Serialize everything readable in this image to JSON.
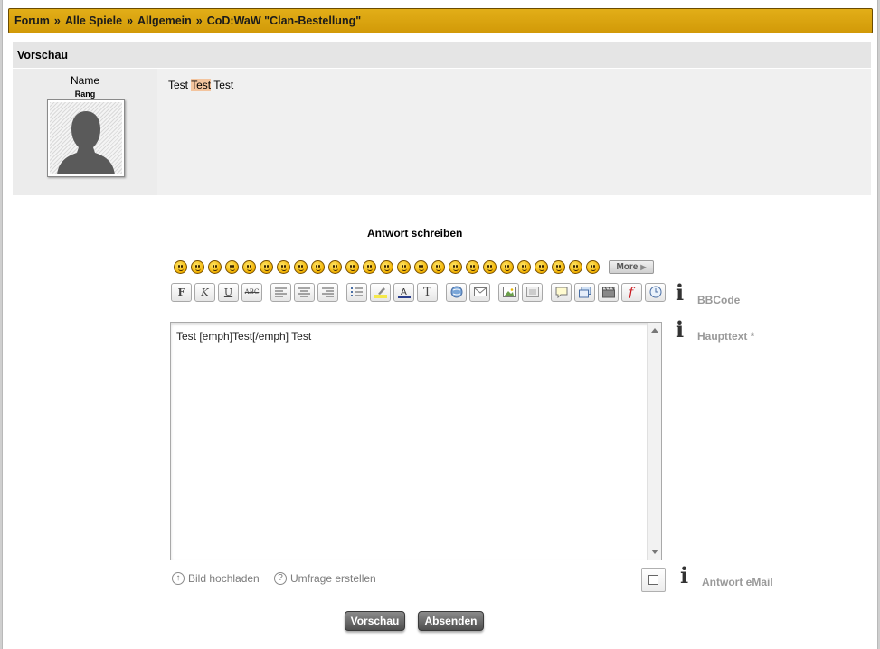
{
  "breadcrumb": {
    "items": [
      "Forum",
      "Alle Spiele",
      "Allgemein",
      "CoD:WaW \"Clan-Bestellung\""
    ],
    "separator": "»"
  },
  "preview": {
    "header": "Vorschau",
    "author_name": "Name",
    "author_rank": "Rang",
    "post_before": "Test ",
    "post_emph": "Test",
    "post_after": " Test"
  },
  "reply": {
    "title": "Antwort schreiben",
    "more_label": "More",
    "smiley_count": 25,
    "toolbar_labels": {
      "bold": "F",
      "italic": "K",
      "underline": "U",
      "strike": "ABC",
      "text_style": "T"
    },
    "bbcode_label": "BBCode",
    "maintext_label": "Haupttext *",
    "textarea_value": "Test [emph]Test[/emph] Test",
    "upload_label": "Bild hochladen",
    "poll_label": "Umfrage erstellen",
    "email_label": "Antwort eMail",
    "preview_button": "Vorschau",
    "submit_button": "Absenden"
  },
  "colors": {
    "breadcrumb_bg": "#d9a20c",
    "emph_highlight": "#f3c49e",
    "button_dark": "#5a5a5a"
  },
  "icons": [
    "info-icon",
    "upload-icon",
    "help-icon",
    "smiley-icon"
  ]
}
